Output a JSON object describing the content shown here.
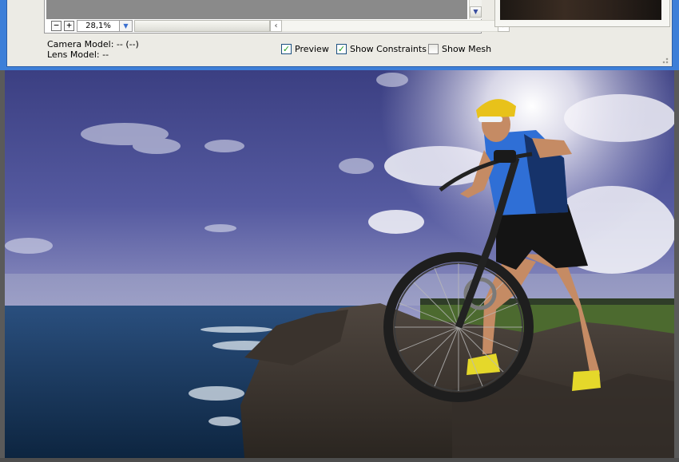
{
  "preview": {
    "zoom_minus": "−",
    "zoom_plus": "+",
    "zoom_value": "28,1%",
    "zoom_dropdown_icon": "triangle-down",
    "scroll_down_icon": "chevron-down",
    "scroll_left_icon": "chevron-left",
    "scroll_right_icon": "chevron-right"
  },
  "meta": {
    "camera_model": "Camera Model: -- (--)",
    "lens_model": "Lens Model: --"
  },
  "options": {
    "preview": {
      "label": "Preview",
      "checked": true
    },
    "show_constraints": {
      "label": "Show Constraints",
      "checked": true
    },
    "show_mesh": {
      "label": "Show Mesh",
      "checked": false
    }
  },
  "colors": {
    "dialog_bg": "#ecebe5",
    "window_frame": "#3d7fd8",
    "check_accent": "#21a121"
  },
  "photo": {
    "subject": "mountain-biker-on-cliff",
    "icons": [
      "sun-flare",
      "bicycle",
      "helmet"
    ]
  }
}
